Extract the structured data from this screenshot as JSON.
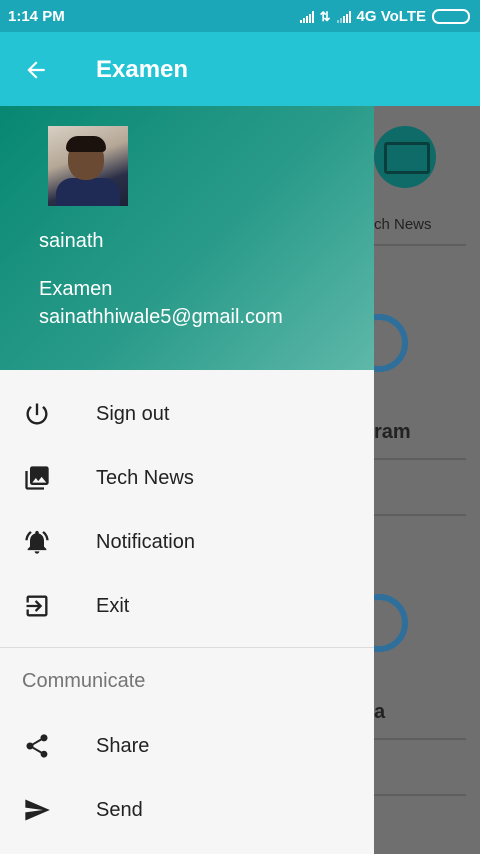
{
  "status": {
    "time": "1:14 PM",
    "network": "4G VoLTE"
  },
  "app_bar": {
    "title": "Examen"
  },
  "background": {
    "tile1_label": "ch News",
    "tile2_label": "ram",
    "tile3_label": "a"
  },
  "drawer": {
    "user_name": "sainath",
    "org": "Examen",
    "email": "sainathhiwale5@gmail.com",
    "items": [
      {
        "label": "Sign out",
        "icon": "power-icon"
      },
      {
        "label": "Tech News",
        "icon": "photo-library-icon"
      },
      {
        "label": "Notification",
        "icon": "alarm-bell-icon"
      },
      {
        "label": "Exit",
        "icon": "exit-icon"
      }
    ],
    "section_title": "Communicate",
    "section_items": [
      {
        "label": "Share",
        "icon": "share-icon"
      },
      {
        "label": "Send",
        "icon": "send-icon"
      }
    ]
  },
  "colors": {
    "status_bar": "#1ba7b8",
    "app_bar": "#24c4d4",
    "header_start": "#078872",
    "header_end": "#5eb8a9"
  }
}
